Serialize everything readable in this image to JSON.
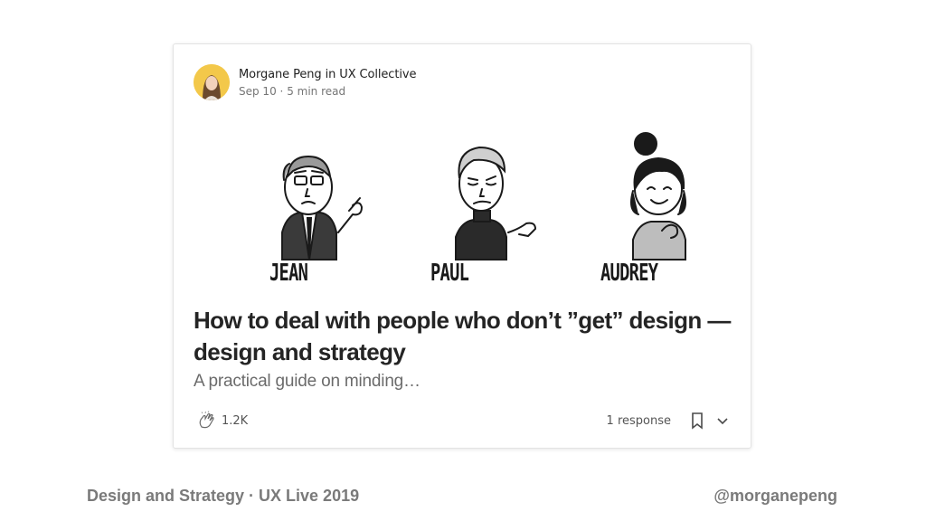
{
  "post": {
    "author": "Morgane Peng",
    "in_word": "in",
    "publication": "UX Collective",
    "date": "Sep 10",
    "separator": "·",
    "read_time": "5 min read",
    "illustration_labels": [
      "JEAN",
      "PAUL",
      "AUDREY"
    ],
    "title": "How to deal with people who don’t ”get” design — design and strategy",
    "subtitle": "A practical guide on minding…",
    "claps": "1.2K",
    "responses": "1 response",
    "icons": [
      "clap-icon",
      "bookmark-icon",
      "chevron-down-icon"
    ]
  },
  "slide": {
    "footer_left": "Design and Strategy · UX Live 2019",
    "footer_right": "@morganepeng"
  },
  "colors": {
    "avatar_bg": "#f3c84a",
    "title": "#242424",
    "muted": "#757575",
    "slide_footer": "#7a7a7a"
  }
}
